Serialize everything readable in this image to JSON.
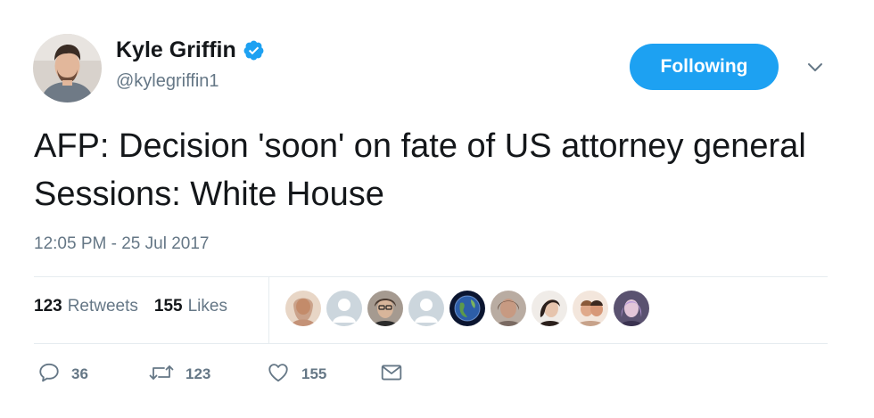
{
  "author": {
    "display_name": "Kyle Griffin",
    "handle": "@kylegriffin1",
    "verified": true,
    "avatar_icon": "profile-photo"
  },
  "follow_button": {
    "label": "Following",
    "color": "#1da1f2"
  },
  "menu_icon": "chevron-down-icon",
  "tweet": {
    "text": "AFP: Decision 'soon' on fate of US attorney general Sessions: White House",
    "timestamp": "12:05 PM - 25 Jul 2017"
  },
  "stats": {
    "retweets": {
      "count": "123",
      "label": "Retweets"
    },
    "likes": {
      "count": "155",
      "label": "Likes"
    }
  },
  "liker_avatars": [
    {
      "icon": "liker-avatar-1",
      "bg": "#c9a084"
    },
    {
      "icon": "liker-avatar-default",
      "bg": "#ccd6dd"
    },
    {
      "icon": "liker-avatar-3",
      "bg": "#6b5a4e"
    },
    {
      "icon": "liker-avatar-default",
      "bg": "#ccd6dd"
    },
    {
      "icon": "liker-avatar-5",
      "bg": "#2a3f6b"
    },
    {
      "icon": "liker-avatar-6",
      "bg": "#8a7a70"
    },
    {
      "icon": "liker-avatar-7",
      "bg": "#3b2e2a"
    },
    {
      "icon": "liker-avatar-8",
      "bg": "#d9b3a0"
    },
    {
      "icon": "liker-avatar-9",
      "bg": "#6a6080"
    }
  ],
  "actions": {
    "reply": {
      "icon": "reply-icon",
      "count": "36"
    },
    "retweet": {
      "icon": "retweet-icon",
      "count": "123"
    },
    "like": {
      "icon": "heart-icon",
      "count": "155"
    },
    "message": {
      "icon": "envelope-icon"
    }
  },
  "colors": {
    "text_primary": "#14171a",
    "text_secondary": "#657786",
    "accent": "#1da1f2",
    "divider": "#e6ecf0"
  }
}
